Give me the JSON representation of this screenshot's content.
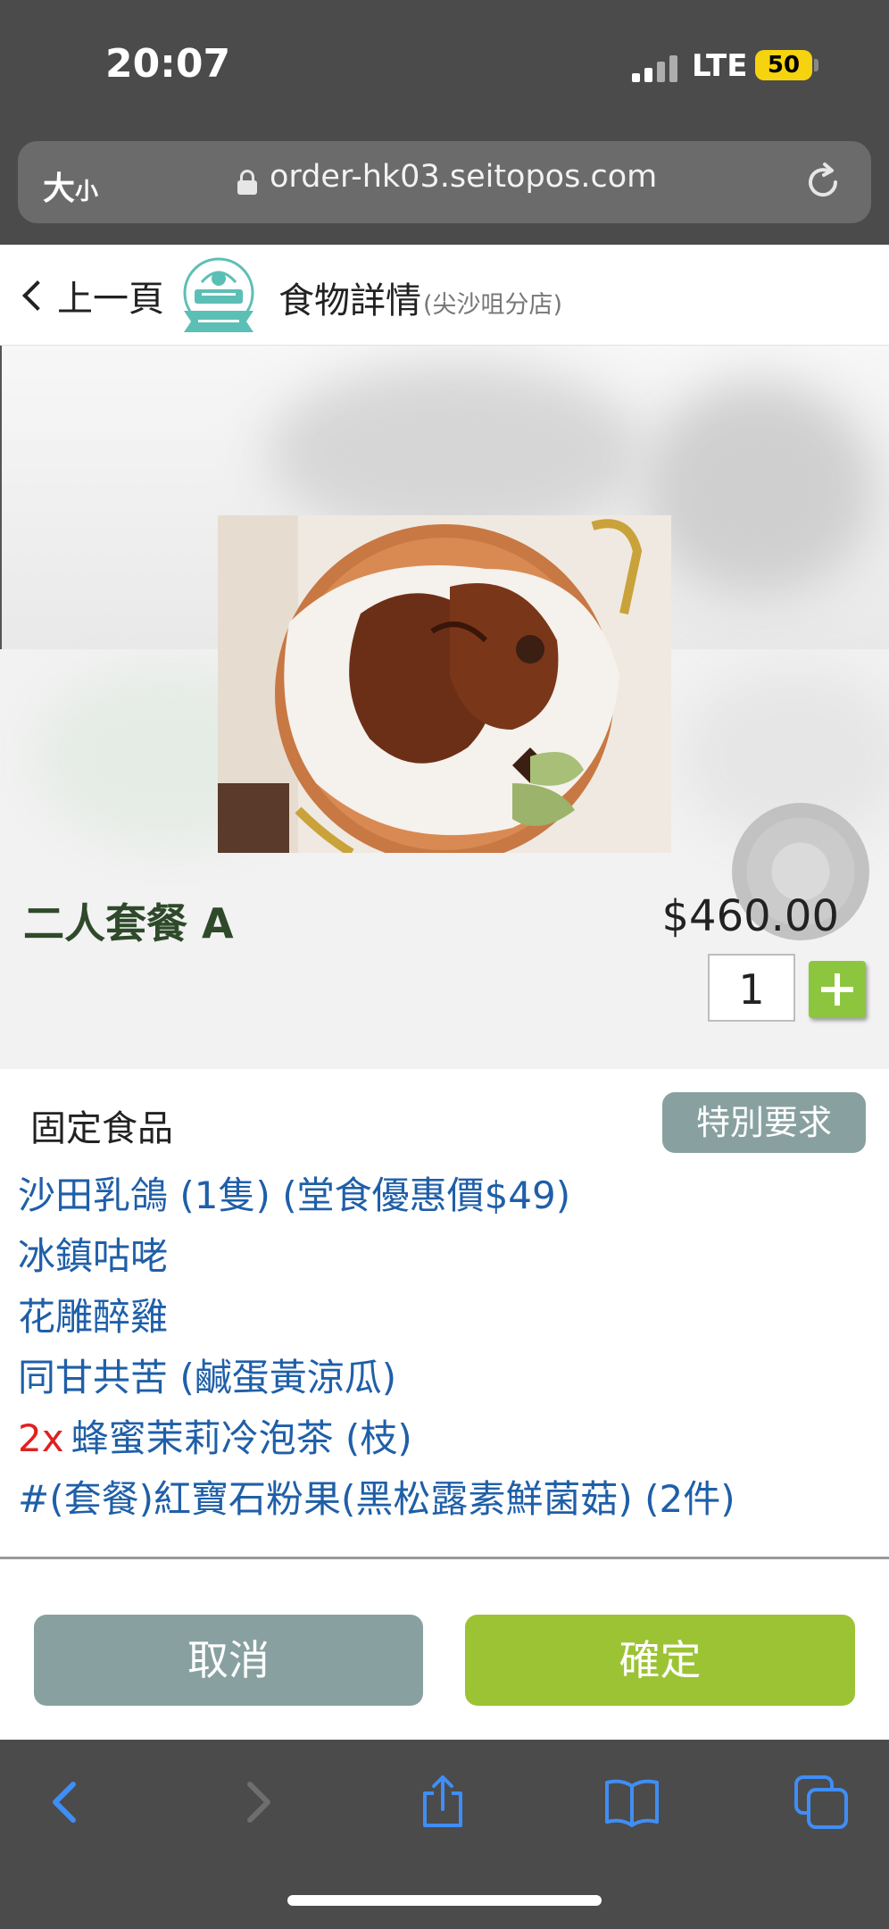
{
  "status_bar": {
    "time": "20:07",
    "network": "LTE",
    "battery": "50"
  },
  "url_bar": {
    "text_size_label": "大",
    "text_size_small": "小",
    "url": "order-hk03.seitopos.com"
  },
  "header": {
    "back_label": "上一頁",
    "title": "食物詳情",
    "branch": "(尖沙咀分店)"
  },
  "item": {
    "name": "二人套餐 A",
    "price": "$460.00",
    "quantity": "1"
  },
  "fixed_section": {
    "label": "固定食品",
    "special_request_label": "特別要求",
    "items": [
      {
        "qty": "",
        "name": "沙田乳鴿 (1隻) (堂食優惠價$49)"
      },
      {
        "qty": "",
        "name": "冰鎮咕咾"
      },
      {
        "qty": "",
        "name": "花雕醉雞"
      },
      {
        "qty": "",
        "name": "同甘共苦 (鹹蛋黃涼瓜)"
      },
      {
        "qty": "2x",
        "name": "蜂蜜茉莉冷泡茶 (枝)"
      },
      {
        "qty": "",
        "name": "#(套餐)紅寶石粉果(黑松露素鮮菌菇) (2件)"
      }
    ]
  },
  "actions": {
    "cancel_label": "取消",
    "confirm_label": "確定"
  },
  "colors": {
    "accent_green": "#9cc334",
    "muted_teal": "#88a1a0",
    "item_link_blue": "#1f5fa8",
    "qty_red": "#e02020",
    "chrome_gray": "#4b4b4b",
    "safari_blue": "#3f8ef5"
  },
  "icons": {
    "logo": "restaurant-logo",
    "reload": "reload-icon",
    "toolbar": [
      "back-arrow-icon",
      "forward-arrow-icon",
      "share-icon",
      "bookmarks-icon",
      "tabs-icon"
    ]
  }
}
